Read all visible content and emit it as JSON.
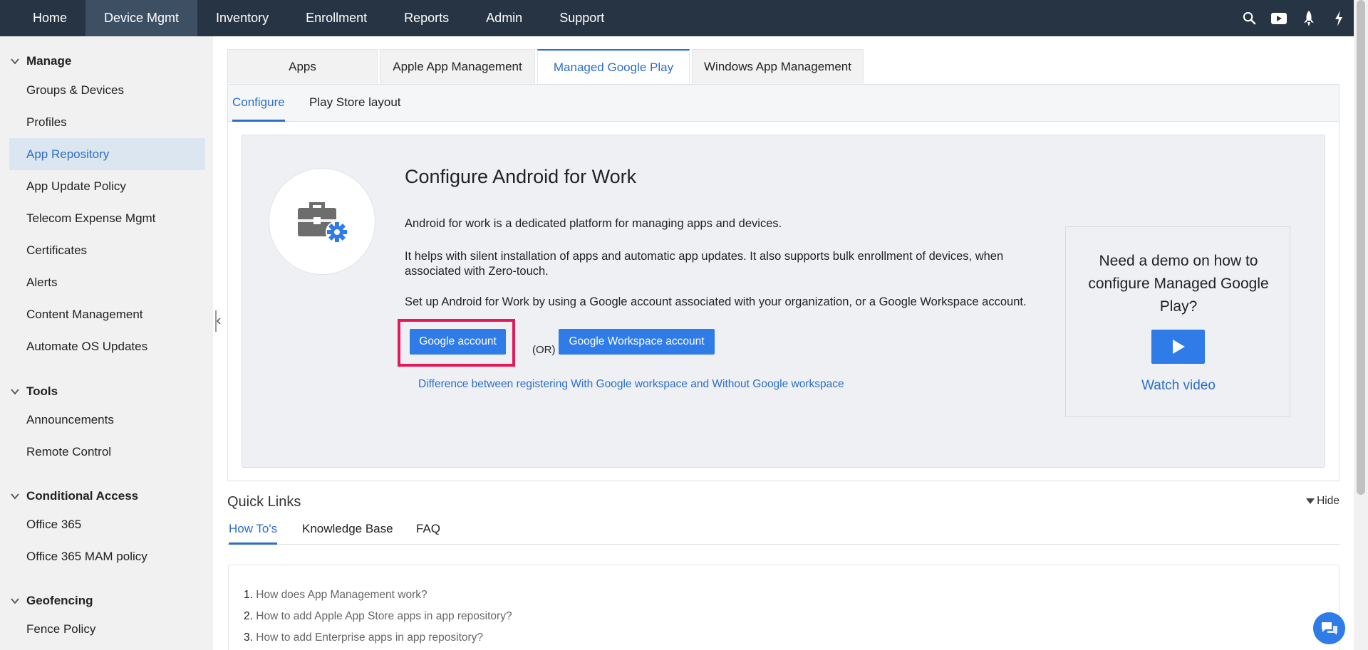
{
  "topnav": {
    "items": [
      "Home",
      "Device Mgmt",
      "Inventory",
      "Enrollment",
      "Reports",
      "Admin",
      "Support"
    ],
    "active_index": 1,
    "icons": [
      "search-icon",
      "youtube-icon",
      "rocket-icon",
      "bolt-icon"
    ]
  },
  "sidebar": {
    "sections": [
      {
        "title": "Manage",
        "items": [
          "Groups & Devices",
          "Profiles",
          "App Repository",
          "App Update Policy",
          "Telecom Expense Mgmt",
          "Certificates",
          "Alerts",
          "Content Management",
          "Automate OS Updates"
        ]
      },
      {
        "title": "Tools",
        "items": [
          "Announcements",
          "Remote Control"
        ]
      },
      {
        "title": "Conditional Access",
        "items": [
          "Office 365",
          "Office 365 MAM policy"
        ]
      },
      {
        "title": "Geofencing",
        "items": [
          "Fence Policy"
        ]
      }
    ],
    "active_item": "App Repository"
  },
  "tabs": [
    "Apps",
    "Apple App Management",
    "Managed Google Play",
    "Windows App Management"
  ],
  "active_tab": "Managed Google Play",
  "subtabs": [
    "Configure",
    "Play Store layout"
  ],
  "active_subtab": "Configure",
  "configure": {
    "icon": "briefcase-gear-icon",
    "title": "Configure Android for Work",
    "p1": "Android for work is a dedicated platform for managing apps and devices.",
    "p2": "It helps with silent installation of apps and automatic app updates. It also supports bulk enrollment of devices, when associated with Zero-touch.",
    "p3": "Set up Android for Work by using a Google account associated with your organization, or a Google Workspace account.",
    "google_account_button": "Google account",
    "or_text": "(OR)",
    "workspace_button": "Google Workspace account",
    "difference_link": "Difference between registering With Google workspace and Without Google workspace"
  },
  "demo": {
    "text": "Need a demo on how to configure Managed Google Play?",
    "watch_label": "Watch video"
  },
  "quick_links": {
    "title": "Quick Links",
    "hide_label": "Hide",
    "tabs": [
      "How To's",
      "Knowledge Base",
      "FAQ"
    ],
    "active_tab": "How To's",
    "howtos": [
      {
        "num": "1.",
        "text": "How does App Management work?"
      },
      {
        "num": "2.",
        "text": "How to add Apple App Store apps in app repository?"
      },
      {
        "num": "3.",
        "text": "How to add Enterprise apps in app repository?"
      }
    ]
  },
  "colors": {
    "nav_bg": "#273443",
    "accent": "#2a6fc9",
    "button": "#2f7be8",
    "highlight": "#e5195a"
  }
}
